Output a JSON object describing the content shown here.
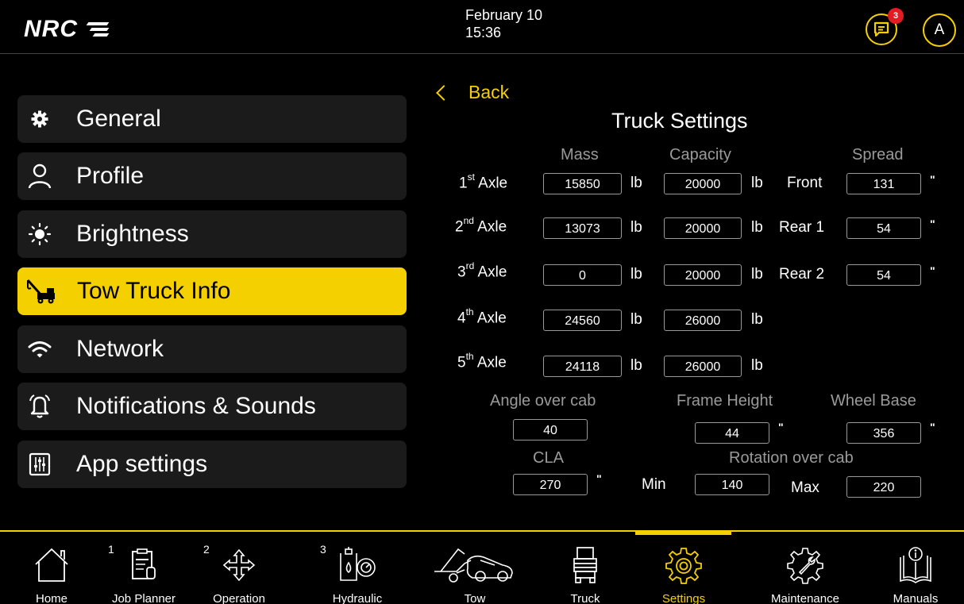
{
  "app": {
    "logo_text": "NRC"
  },
  "header": {
    "date": "February 10",
    "time": "15:36",
    "message_count": "3",
    "avatar_initial": "A"
  },
  "sidebar": {
    "items": [
      {
        "label": "General",
        "icon": "gear-icon"
      },
      {
        "label": "Profile",
        "icon": "user-icon"
      },
      {
        "label": "Brightness",
        "icon": "sun-icon"
      },
      {
        "label": "Tow Truck Info",
        "icon": "tow-truck-icon",
        "active": true
      },
      {
        "label": "Network",
        "icon": "wifi-icon"
      },
      {
        "label": "Notifications & Sounds",
        "icon": "bell-icon"
      },
      {
        "label": "App settings",
        "icon": "sliders-icon"
      }
    ]
  },
  "panel": {
    "back_label": "Back",
    "title": "Truck Settings",
    "headers": {
      "mass": "Mass",
      "capacity": "Capacity",
      "spread": "Spread"
    },
    "axles": [
      {
        "num": "1",
        "ord": "st",
        "name": "Axle",
        "mass": "15850",
        "mass_unit": "lb",
        "capacity": "20000",
        "capacity_unit": "lb",
        "spread_label": "Front",
        "spread": "131",
        "spread_unit": "\""
      },
      {
        "num": "2",
        "ord": "nd",
        "name": "Axle",
        "mass": "13073",
        "mass_unit": "lb",
        "capacity": "20000",
        "capacity_unit": "lb",
        "spread_label": "Rear 1",
        "spread": "54",
        "spread_unit": "\""
      },
      {
        "num": "3",
        "ord": "rd",
        "name": "Axle",
        "mass": "0",
        "mass_unit": "lb",
        "capacity": "20000",
        "capacity_unit": "lb",
        "spread_label": "Rear 2",
        "spread": "54",
        "spread_unit": "\""
      },
      {
        "num": "4",
        "ord": "th",
        "name": "Axle",
        "mass": "24560",
        "mass_unit": "lb",
        "capacity": "26000",
        "capacity_unit": "lb"
      },
      {
        "num": "5",
        "ord": "th",
        "name": "Axle",
        "mass": "24118",
        "mass_unit": "lb",
        "capacity": "26000",
        "capacity_unit": "lb"
      }
    ],
    "angle_over_cab": {
      "label": "Angle over cab",
      "value": "40"
    },
    "frame_height": {
      "label": "Frame Height",
      "value": "44",
      "unit": "\""
    },
    "wheel_base": {
      "label": "Wheel Base",
      "value": "356",
      "unit": "\""
    },
    "cla": {
      "label": "CLA",
      "value": "270",
      "unit": "\""
    },
    "rotation_over_cab": {
      "label": "Rotation over cab",
      "min_label": "Min",
      "min": "140",
      "max_label": "Max",
      "max": "220"
    }
  },
  "bottomnav": {
    "items": [
      {
        "label": "Home",
        "icon": "home-icon"
      },
      {
        "label": "Job Planner",
        "icon": "job-planner-icon",
        "badge": "1"
      },
      {
        "label": "Operation",
        "icon": "move-arrows-icon",
        "badge": "2"
      },
      {
        "label": "Hydraulic",
        "icon": "hydraulic-icon",
        "badge": "3"
      },
      {
        "label": "Tow",
        "icon": "tow-icon"
      },
      {
        "label": "Truck",
        "icon": "truck-icon"
      },
      {
        "label": "Settings",
        "icon": "settings-gear-icon",
        "active": true
      },
      {
        "label": "Maintenance",
        "icon": "maintenance-icon"
      },
      {
        "label": "Manuals",
        "icon": "manual-icon"
      }
    ]
  },
  "colors": {
    "accent": "#f5d000",
    "badge": "#e31b23",
    "item_bg": "#1b1b1b",
    "muted": "#9a9a9a"
  }
}
